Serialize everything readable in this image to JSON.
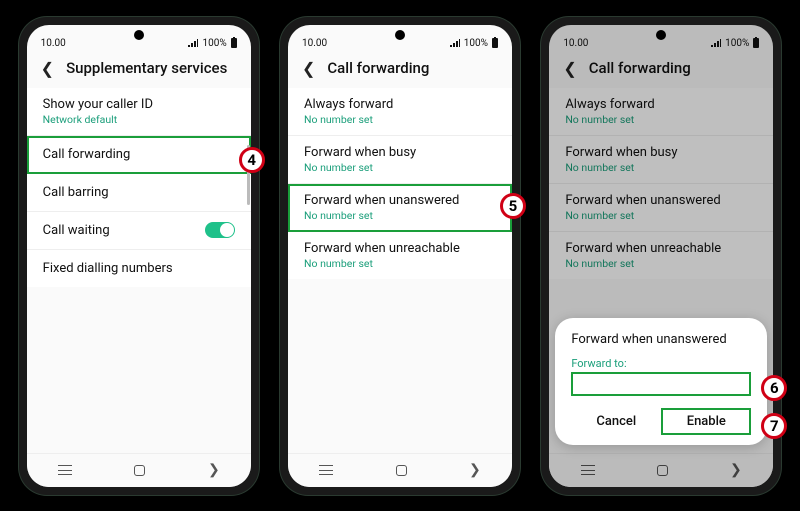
{
  "statusbar": {
    "time": "10.00",
    "battery": "100%"
  },
  "phone1": {
    "header": "Supplementary services",
    "rows": [
      {
        "title": "Show your caller ID",
        "sub": "Network default"
      },
      {
        "title": "Call forwarding"
      },
      {
        "title": "Call barring"
      },
      {
        "title": "Call waiting"
      },
      {
        "title": "Fixed dialling numbers"
      }
    ],
    "marker": "4"
  },
  "phone2": {
    "header": "Call forwarding",
    "rows": [
      {
        "title": "Always forward",
        "sub": "No number set"
      },
      {
        "title": "Forward when busy",
        "sub": "No number set"
      },
      {
        "title": "Forward when unanswered",
        "sub": "No number set"
      },
      {
        "title": "Forward when unreachable",
        "sub": "No number set"
      }
    ],
    "marker": "5"
  },
  "phone3": {
    "header": "Call forwarding",
    "rows": [
      {
        "title": "Always forward",
        "sub": "No number set"
      },
      {
        "title": "Forward when busy",
        "sub": "No number set"
      },
      {
        "title": "Forward when unanswered",
        "sub": "No number set"
      },
      {
        "title": "Forward when unreachable",
        "sub": "No number set"
      }
    ],
    "dialog": {
      "title": "Forward when unanswered",
      "label": "Forward to:",
      "cancel": "Cancel",
      "enable": "Enable"
    },
    "marker6": "6",
    "marker7": "7"
  }
}
